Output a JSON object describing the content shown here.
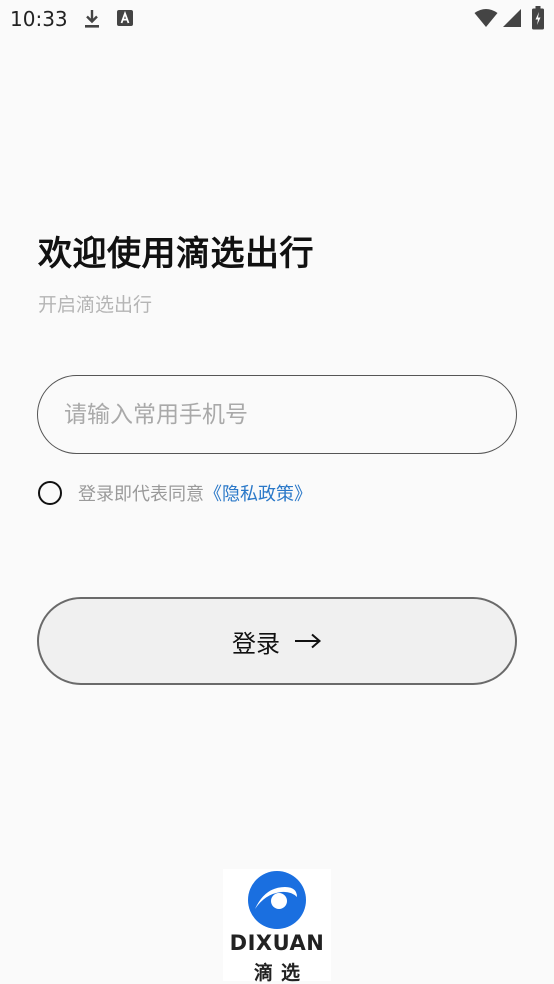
{
  "status_bar": {
    "time": "10:33",
    "icons": [
      "download-icon",
      "a-icon",
      "wifi-icon",
      "signal-icon",
      "battery-icon"
    ]
  },
  "header": {
    "title": "欢迎使用滴选出行",
    "subtitle": "开启滴选出行"
  },
  "phone": {
    "placeholder": "请输入常用手机号",
    "value": ""
  },
  "agreement": {
    "checked": false,
    "text": "登录即代表同意",
    "link_label": "《隐私政策》"
  },
  "login": {
    "label": "登录",
    "arrow_icon": "arrow-right-icon"
  },
  "logo": {
    "text": "DIXUAN",
    "subtext": "滴选"
  },
  "colors": {
    "background": "#fafafa",
    "link": "#2a78c8",
    "logo_blue": "#1a6fe0",
    "button_bg": "#f0f0f0",
    "button_border": "#6a6a6a"
  }
}
